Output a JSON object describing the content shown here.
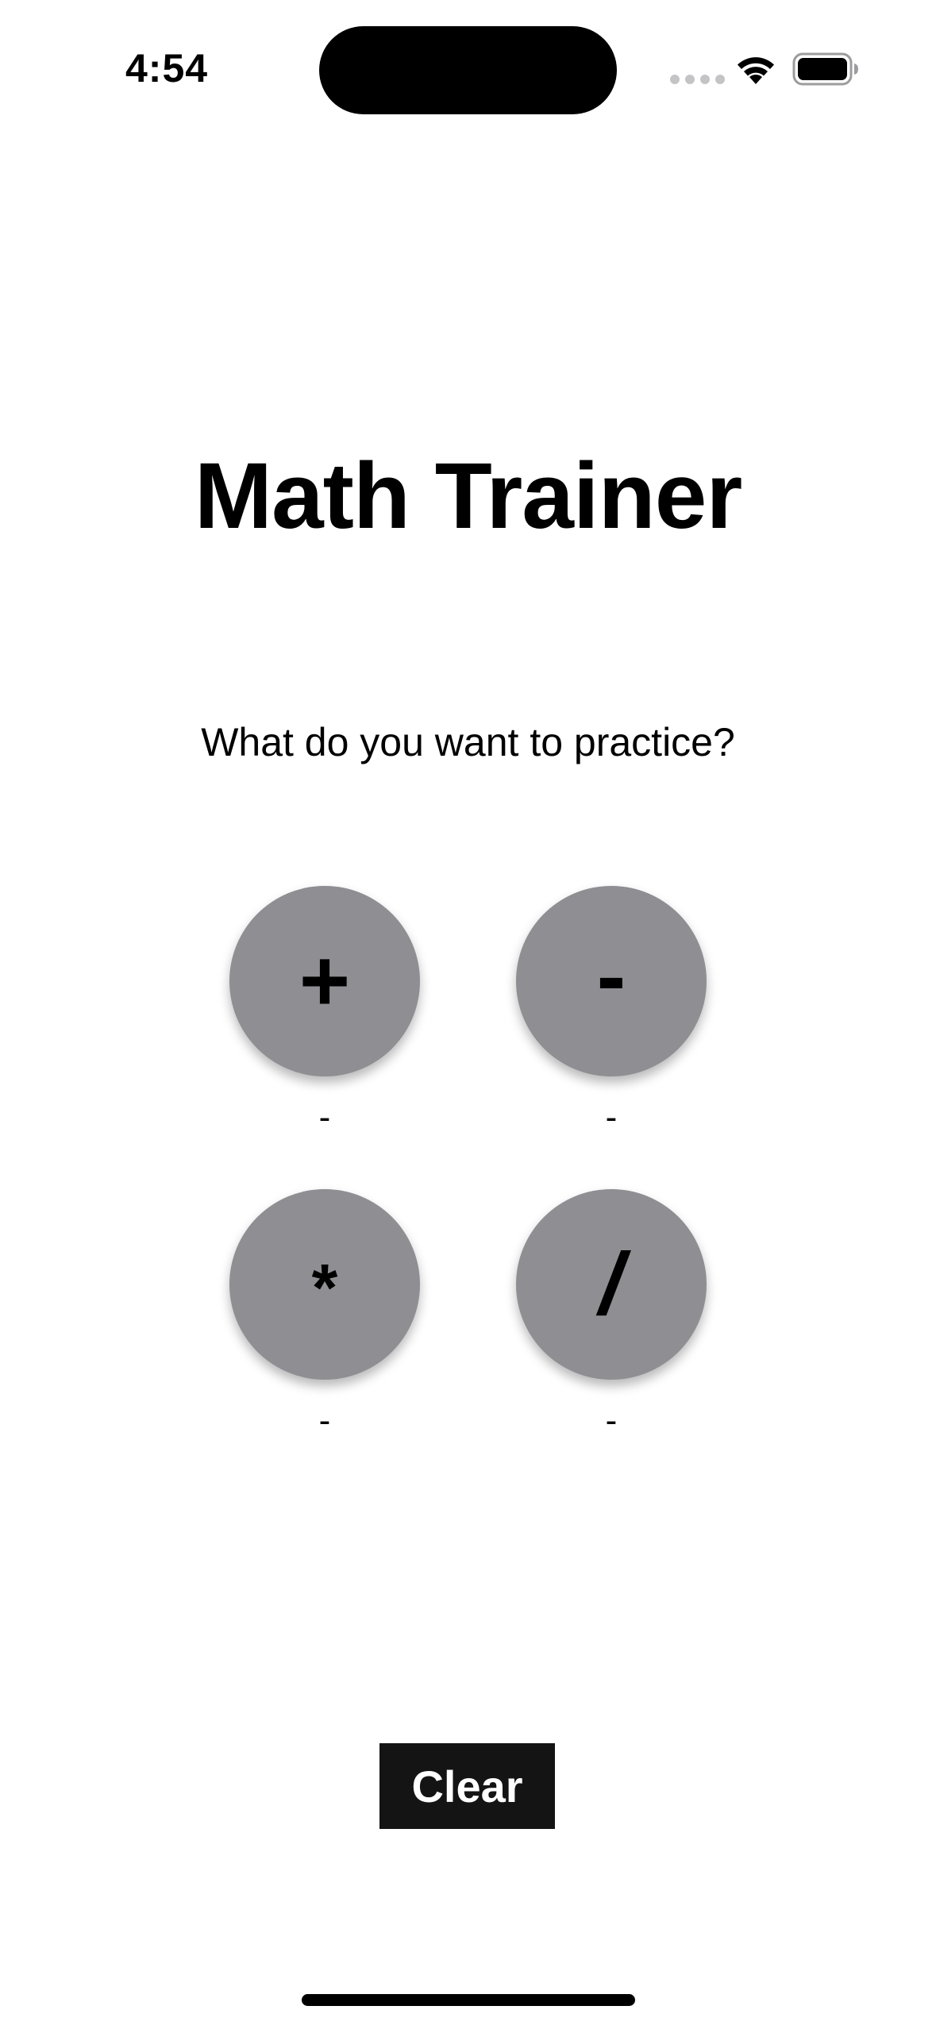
{
  "status_bar": {
    "time": "4:54",
    "wifi_icon": "wifi-icon",
    "battery_icon": "battery-icon"
  },
  "app": {
    "title": "Math Trainer",
    "prompt": "What do you want to practice?"
  },
  "operations": [
    {
      "symbol": "+",
      "score": "-"
    },
    {
      "symbol": "-",
      "score": "-"
    },
    {
      "symbol": "*",
      "score": "-"
    },
    {
      "symbol": "/",
      "score": "-"
    }
  ],
  "actions": {
    "clear_label": "Clear"
  },
  "colors": {
    "button_fill": "#8e8e93",
    "clear_fill": "#141414",
    "text": "#000000"
  }
}
